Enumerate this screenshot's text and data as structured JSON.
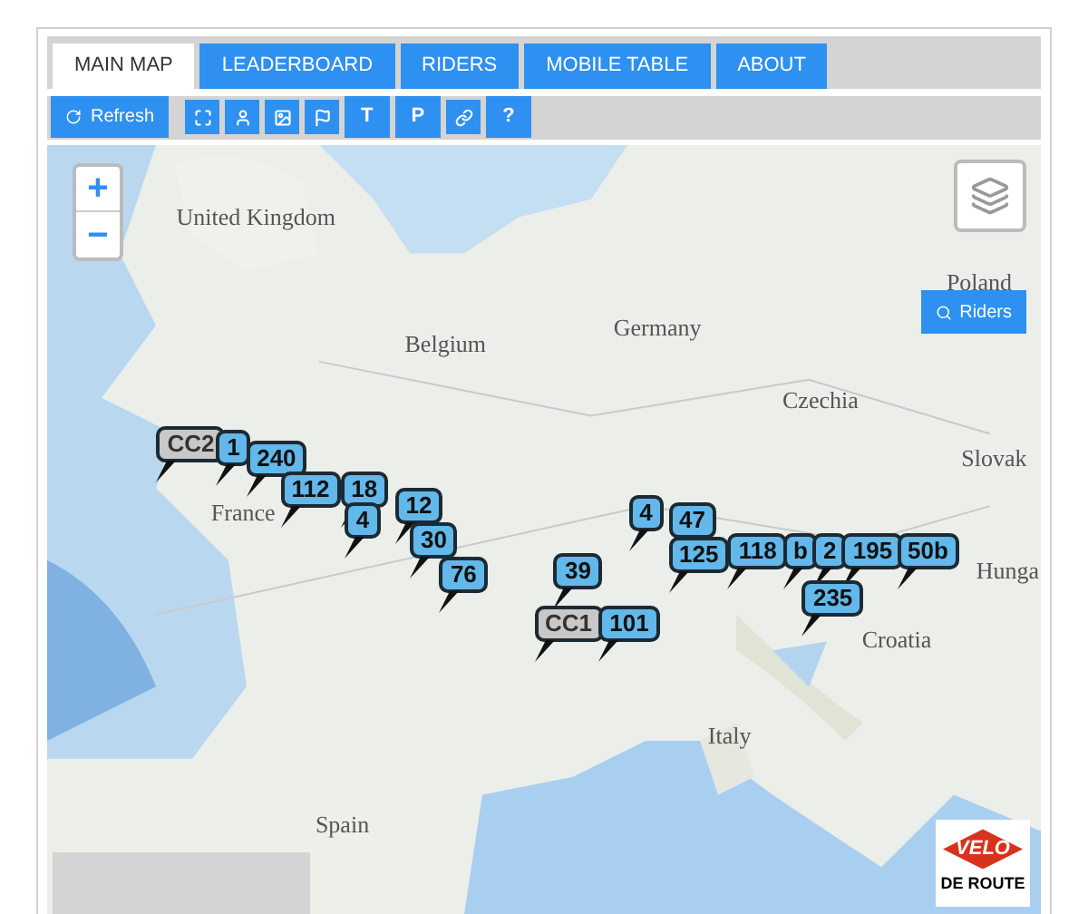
{
  "tabs": [
    {
      "label": "MAIN MAP",
      "selected": true
    },
    {
      "label": "LEADERBOARD",
      "selected": false
    },
    {
      "label": "RIDERS",
      "selected": false
    },
    {
      "label": "MOBILE TABLE",
      "selected": false
    },
    {
      "label": "ABOUT",
      "selected": false
    }
  ],
  "toolbar": {
    "refresh": "Refresh",
    "tools": [
      {
        "kind": "icon"
      },
      {
        "kind": "icon"
      },
      {
        "kind": "icon"
      },
      {
        "kind": "icon"
      },
      {
        "kind": "text",
        "label": "T"
      },
      {
        "kind": "text",
        "label": "P"
      },
      {
        "kind": "icon"
      },
      {
        "kind": "text",
        "label": "?"
      }
    ]
  },
  "map": {
    "zoom_in": "+",
    "zoom_out": "−",
    "riders_button": "Riders",
    "places": [
      "United Kingdom",
      "Belgium",
      "Germany",
      "Poland",
      "Czechia",
      "Slovak",
      "France",
      "Hunga",
      "Croatia",
      "Italy",
      "Spain"
    ],
    "markers": [
      {
        "label": "CC2",
        "kind": "checkpoint"
      },
      {
        "label": "1",
        "kind": "rider"
      },
      {
        "label": "240",
        "kind": "rider"
      },
      {
        "label": "112",
        "kind": "rider"
      },
      {
        "label": "18",
        "kind": "rider"
      },
      {
        "label": "4",
        "kind": "rider"
      },
      {
        "label": "12",
        "kind": "rider"
      },
      {
        "label": "30",
        "kind": "rider"
      },
      {
        "label": "76",
        "kind": "rider"
      },
      {
        "label": "39",
        "kind": "rider"
      },
      {
        "label": "4",
        "kind": "rider"
      },
      {
        "label": "47",
        "kind": "rider"
      },
      {
        "label": "125",
        "kind": "rider"
      },
      {
        "label": "118",
        "kind": "rider"
      },
      {
        "label": "b",
        "kind": "rider"
      },
      {
        "label": "2",
        "kind": "rider"
      },
      {
        "label": "195",
        "kind": "rider"
      },
      {
        "label": "50b",
        "kind": "rider"
      },
      {
        "label": "235",
        "kind": "rider"
      },
      {
        "label": "CC1",
        "kind": "checkpoint"
      },
      {
        "label": "101",
        "kind": "rider"
      }
    ],
    "logo": {
      "top": "VELO",
      "bottom": "DE ROUTE"
    }
  }
}
